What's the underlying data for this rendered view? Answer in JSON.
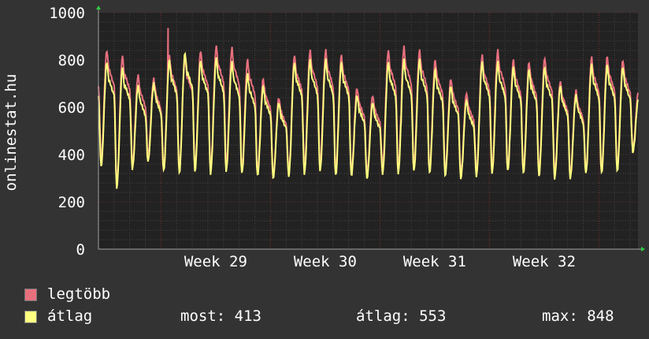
{
  "colors": {
    "background": "#333333",
    "plot_background": "#222222",
    "grid": "#444444",
    "week_line": "#7a2a2a",
    "max_series": "#e8707e",
    "avg_series": "#ffff80",
    "axis": "#a0a0a0",
    "arrow": "#2ecc40"
  },
  "y_axis_label": "onlinestat.hu",
  "legend": {
    "items": [
      {
        "label": "legtöbb",
        "color": "#e8707e"
      },
      {
        "label": "átlag",
        "color": "#ffff80"
      }
    ],
    "stats": {
      "now_label": "most: 413",
      "avg_label": "átlag: 553",
      "max_label": "max: 848"
    }
  },
  "chart_data": {
    "type": "line",
    "title": "",
    "ylabel": "onlinestat.hu",
    "ylim": [
      0,
      1000
    ],
    "yticks": [
      0,
      200,
      400,
      600,
      800,
      1000
    ],
    "x_unit": "days",
    "xlim": [
      0,
      34.5
    ],
    "xticks": [
      {
        "label": "Week 29",
        "day": 7.5
      },
      {
        "label": "Week 30",
        "day": 14.5
      },
      {
        "label": "Week 31",
        "day": 21.5
      },
      {
        "label": "Week 32",
        "day": 28.5
      }
    ],
    "week_boundaries": [
      4,
      11,
      18,
      25,
      32
    ],
    "daily": {
      "legtöbb_peak": [
        840,
        820,
        735,
        720,
        820,
        810,
        840,
        860,
        850,
        800,
        720,
        640,
        820,
        840,
        840,
        820,
        680,
        650,
        840,
        855,
        840,
        800,
        720,
        660,
        820,
        840,
        800,
        790,
        810,
        710,
        670,
        810,
        815,
        800,
        670
      ],
      "legtöbb_trough": [
        380,
        270,
        360,
        400,
        350,
        340,
        345,
        340,
        360,
        340,
        330,
        310,
        330,
        350,
        360,
        340,
        330,
        320,
        350,
        350,
        360,
        340,
        330,
        320,
        330,
        340,
        350,
        340,
        330,
        320,
        320,
        340,
        340,
        350,
        420
      ],
      "átlag_peak": [
        790,
        770,
        690,
        700,
        800,
        830,
        800,
        810,
        790,
        740,
        690,
        620,
        790,
        800,
        800,
        790,
        650,
        620,
        790,
        800,
        800,
        760,
        690,
        630,
        790,
        790,
        770,
        760,
        770,
        690,
        650,
        780,
        780,
        770,
        640
      ],
      "átlag_trough": [
        350,
        260,
        340,
        370,
        330,
        320,
        330,
        320,
        330,
        320,
        310,
        300,
        310,
        320,
        330,
        310,
        310,
        300,
        320,
        320,
        330,
        320,
        310,
        300,
        310,
        320,
        330,
        320,
        310,
        300,
        300,
        320,
        320,
        330,
        410
      ]
    },
    "spikes": [
      {
        "series": "legtöbb",
        "day": 4.45,
        "value": 935
      },
      {
        "series": "legtöbb",
        "day": 19.35,
        "value": 560
      },
      {
        "series": "átlag",
        "day": 19.35,
        "value": 530
      }
    ],
    "series": [
      {
        "name": "legtöbb",
        "color": "#e8707e"
      },
      {
        "name": "átlag",
        "color": "#ffff80"
      }
    ],
    "last_value": 413
  }
}
